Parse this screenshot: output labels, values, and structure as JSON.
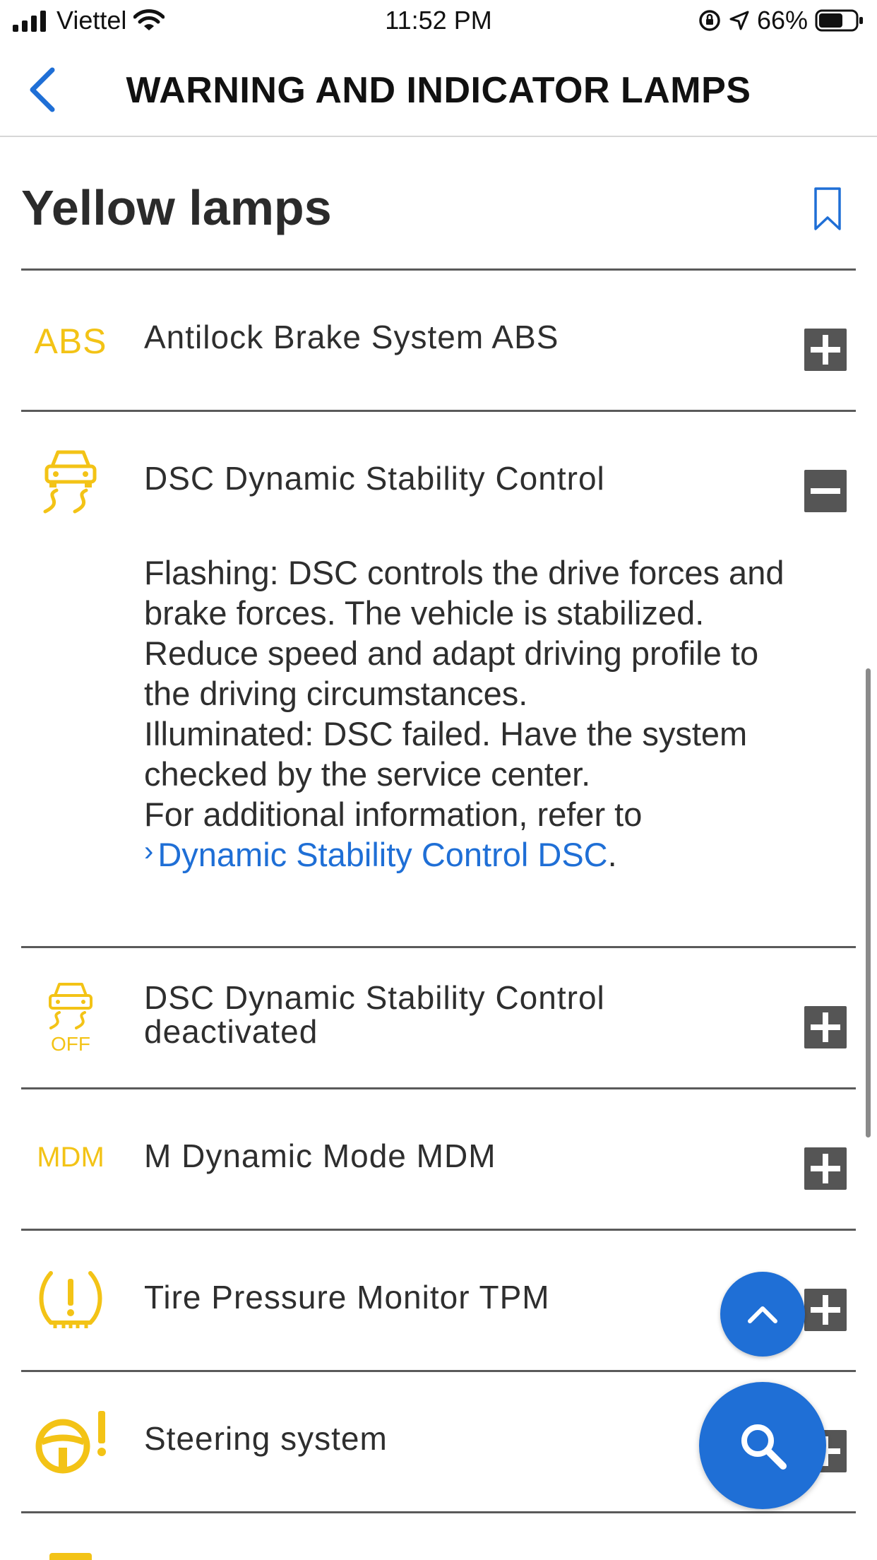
{
  "status_bar": {
    "carrier": "Viettel",
    "time": "11:52 PM",
    "battery_percent": "66%",
    "signal_bars": 4,
    "battery_level": 0.66
  },
  "nav": {
    "title": "WARNING AND INDICATOR LAMPS",
    "back_icon": "chevron-left-icon"
  },
  "section": {
    "title": "Yellow lamps",
    "bookmark_icon": "bookmark-icon"
  },
  "lamps": [
    {
      "icon": "abs-icon",
      "icon_text": "ABS",
      "title": "Antilock Brake System ABS",
      "expanded": false
    },
    {
      "icon": "dsc-car-skid-icon",
      "title": "DSC Dynamic Stability Control",
      "expanded": true
    },
    {
      "icon": "dsc-off-icon",
      "icon_text": "OFF",
      "title": "DSC Dynamic Stability Control deactivated",
      "expanded": false
    },
    {
      "icon": "mdm-icon",
      "icon_text": "MDM",
      "title": "M Dynamic Mode MDM",
      "expanded": false
    },
    {
      "icon": "tire-pressure-icon",
      "title": "Tire Pressure Monitor TPM",
      "expanded": false
    },
    {
      "icon": "steering-wheel-warning-icon",
      "title": "Steering system",
      "expanded": false
    }
  ],
  "dsc_description": {
    "flashing": "Flashing: DSC controls the drive forces and brake forces. The vehicle is stabilized. Reduce speed and adapt driving profile to the driving circumstances.",
    "illuminated": "Illuminated: DSC failed. Have the system checked by the service center.",
    "refer": "For additional information, refer to",
    "link": "Dynamic Stability Control DSC",
    "end": "."
  },
  "buttons": {
    "scroll_top_icon": "chevron-up-icon",
    "search_icon": "search-icon"
  },
  "colors": {
    "lamp_yellow": "#f3c316",
    "accent_blue": "#1f6fd6",
    "toggle_gray": "#555555"
  }
}
